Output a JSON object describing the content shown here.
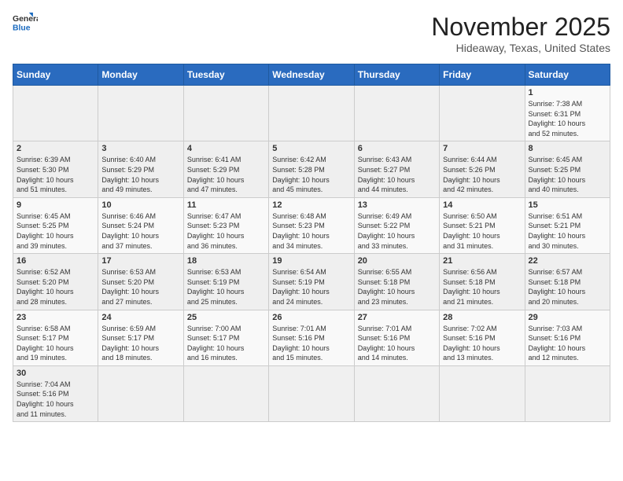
{
  "header": {
    "logo_general": "General",
    "logo_blue": "Blue",
    "month_title": "November 2025",
    "location": "Hideaway, Texas, United States"
  },
  "weekdays": [
    "Sunday",
    "Monday",
    "Tuesday",
    "Wednesday",
    "Thursday",
    "Friday",
    "Saturday"
  ],
  "weeks": [
    [
      {
        "day": "",
        "info": ""
      },
      {
        "day": "",
        "info": ""
      },
      {
        "day": "",
        "info": ""
      },
      {
        "day": "",
        "info": ""
      },
      {
        "day": "",
        "info": ""
      },
      {
        "day": "",
        "info": ""
      },
      {
        "day": "1",
        "info": "Sunrise: 7:38 AM\nSunset: 6:31 PM\nDaylight: 10 hours\nand 52 minutes."
      }
    ],
    [
      {
        "day": "2",
        "info": "Sunrise: 6:39 AM\nSunset: 5:30 PM\nDaylight: 10 hours\nand 51 minutes."
      },
      {
        "day": "3",
        "info": "Sunrise: 6:40 AM\nSunset: 5:29 PM\nDaylight: 10 hours\nand 49 minutes."
      },
      {
        "day": "4",
        "info": "Sunrise: 6:41 AM\nSunset: 5:29 PM\nDaylight: 10 hours\nand 47 minutes."
      },
      {
        "day": "5",
        "info": "Sunrise: 6:42 AM\nSunset: 5:28 PM\nDaylight: 10 hours\nand 45 minutes."
      },
      {
        "day": "6",
        "info": "Sunrise: 6:43 AM\nSunset: 5:27 PM\nDaylight: 10 hours\nand 44 minutes."
      },
      {
        "day": "7",
        "info": "Sunrise: 6:44 AM\nSunset: 5:26 PM\nDaylight: 10 hours\nand 42 minutes."
      },
      {
        "day": "8",
        "info": "Sunrise: 6:45 AM\nSunset: 5:25 PM\nDaylight: 10 hours\nand 40 minutes."
      }
    ],
    [
      {
        "day": "9",
        "info": "Sunrise: 6:45 AM\nSunset: 5:25 PM\nDaylight: 10 hours\nand 39 minutes."
      },
      {
        "day": "10",
        "info": "Sunrise: 6:46 AM\nSunset: 5:24 PM\nDaylight: 10 hours\nand 37 minutes."
      },
      {
        "day": "11",
        "info": "Sunrise: 6:47 AM\nSunset: 5:23 PM\nDaylight: 10 hours\nand 36 minutes."
      },
      {
        "day": "12",
        "info": "Sunrise: 6:48 AM\nSunset: 5:23 PM\nDaylight: 10 hours\nand 34 minutes."
      },
      {
        "day": "13",
        "info": "Sunrise: 6:49 AM\nSunset: 5:22 PM\nDaylight: 10 hours\nand 33 minutes."
      },
      {
        "day": "14",
        "info": "Sunrise: 6:50 AM\nSunset: 5:21 PM\nDaylight: 10 hours\nand 31 minutes."
      },
      {
        "day": "15",
        "info": "Sunrise: 6:51 AM\nSunset: 5:21 PM\nDaylight: 10 hours\nand 30 minutes."
      }
    ],
    [
      {
        "day": "16",
        "info": "Sunrise: 6:52 AM\nSunset: 5:20 PM\nDaylight: 10 hours\nand 28 minutes."
      },
      {
        "day": "17",
        "info": "Sunrise: 6:53 AM\nSunset: 5:20 PM\nDaylight: 10 hours\nand 27 minutes."
      },
      {
        "day": "18",
        "info": "Sunrise: 6:53 AM\nSunset: 5:19 PM\nDaylight: 10 hours\nand 25 minutes."
      },
      {
        "day": "19",
        "info": "Sunrise: 6:54 AM\nSunset: 5:19 PM\nDaylight: 10 hours\nand 24 minutes."
      },
      {
        "day": "20",
        "info": "Sunrise: 6:55 AM\nSunset: 5:18 PM\nDaylight: 10 hours\nand 23 minutes."
      },
      {
        "day": "21",
        "info": "Sunrise: 6:56 AM\nSunset: 5:18 PM\nDaylight: 10 hours\nand 21 minutes."
      },
      {
        "day": "22",
        "info": "Sunrise: 6:57 AM\nSunset: 5:18 PM\nDaylight: 10 hours\nand 20 minutes."
      }
    ],
    [
      {
        "day": "23",
        "info": "Sunrise: 6:58 AM\nSunset: 5:17 PM\nDaylight: 10 hours\nand 19 minutes."
      },
      {
        "day": "24",
        "info": "Sunrise: 6:59 AM\nSunset: 5:17 PM\nDaylight: 10 hours\nand 18 minutes."
      },
      {
        "day": "25",
        "info": "Sunrise: 7:00 AM\nSunset: 5:17 PM\nDaylight: 10 hours\nand 16 minutes."
      },
      {
        "day": "26",
        "info": "Sunrise: 7:01 AM\nSunset: 5:16 PM\nDaylight: 10 hours\nand 15 minutes."
      },
      {
        "day": "27",
        "info": "Sunrise: 7:01 AM\nSunset: 5:16 PM\nDaylight: 10 hours\nand 14 minutes."
      },
      {
        "day": "28",
        "info": "Sunrise: 7:02 AM\nSunset: 5:16 PM\nDaylight: 10 hours\nand 13 minutes."
      },
      {
        "day": "29",
        "info": "Sunrise: 7:03 AM\nSunset: 5:16 PM\nDaylight: 10 hours\nand 12 minutes."
      }
    ],
    [
      {
        "day": "30",
        "info": "Sunrise: 7:04 AM\nSunset: 5:16 PM\nDaylight: 10 hours\nand 11 minutes."
      },
      {
        "day": "",
        "info": ""
      },
      {
        "day": "",
        "info": ""
      },
      {
        "day": "",
        "info": ""
      },
      {
        "day": "",
        "info": ""
      },
      {
        "day": "",
        "info": ""
      },
      {
        "day": "",
        "info": ""
      }
    ]
  ]
}
